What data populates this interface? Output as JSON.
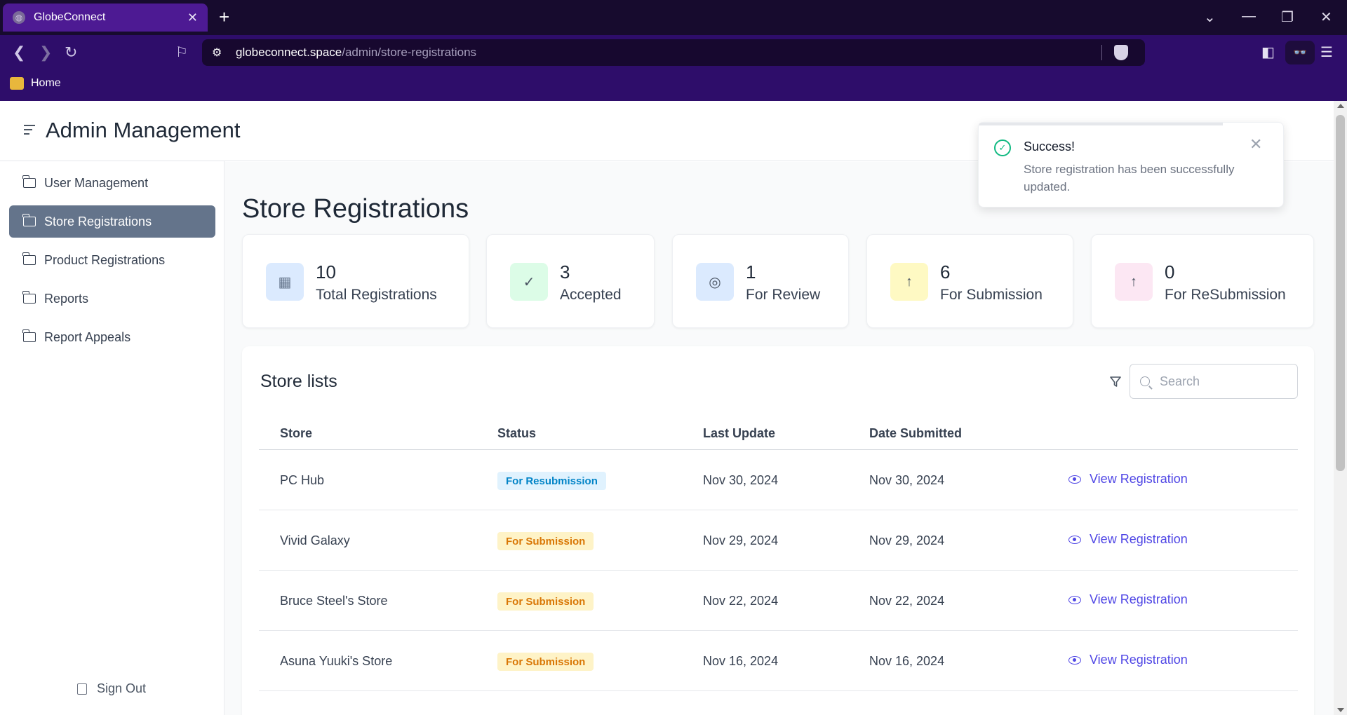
{
  "browser": {
    "tab_title": "GlobeConnect",
    "url_domain": "globeconnect.space",
    "url_path": "/admin/store-registrations",
    "bookmark_home": "Home"
  },
  "header": {
    "title": "Admin Management"
  },
  "sidebar": {
    "items": [
      {
        "label": "User Management",
        "active": false
      },
      {
        "label": "Store Registrations",
        "active": true
      },
      {
        "label": "Product Registrations",
        "active": false
      },
      {
        "label": "Reports",
        "active": false
      },
      {
        "label": "Report Appeals",
        "active": false
      }
    ],
    "sign_out": "Sign Out"
  },
  "main": {
    "page_title": "Store Registrations",
    "stats": [
      {
        "value": "10",
        "label": "Total Registrations",
        "icon": "store-icon",
        "color": "#dbeafe"
      },
      {
        "value": "3",
        "label": "Accepted",
        "icon": "file-check-icon",
        "color": "#dcfce7"
      },
      {
        "value": "1",
        "label": "For Review",
        "icon": "file-search-icon",
        "color": "#dbeafe"
      },
      {
        "value": "6",
        "label": "For Submission",
        "icon": "file-upload-icon",
        "color": "#fef9c3"
      },
      {
        "value": "0",
        "label": "For ReSubmission",
        "icon": "file-upload-icon",
        "color": "#fce7f3"
      }
    ],
    "list": {
      "title": "Store lists",
      "search_placeholder": "Search",
      "columns": [
        "Store",
        "Status",
        "Last Update",
        "Date Submitted"
      ],
      "action_label": "View Registration",
      "rows": [
        {
          "store": "PC Hub",
          "status": "For Resubmission",
          "last_update": "Nov 30, 2024",
          "date_submitted": "Nov 30, 2024"
        },
        {
          "store": "Vivid Galaxy",
          "status": "For Submission",
          "last_update": "Nov 29, 2024",
          "date_submitted": "Nov 29, 2024"
        },
        {
          "store": "Bruce Steel's Store",
          "status": "For Submission",
          "last_update": "Nov 22, 2024",
          "date_submitted": "Nov 22, 2024"
        },
        {
          "store": "Asuna Yuuki's Store",
          "status": "For Submission",
          "last_update": "Nov 16, 2024",
          "date_submitted": "Nov 16, 2024"
        }
      ]
    }
  },
  "toast": {
    "title": "Success!",
    "message": "Store registration has been successfully updated."
  },
  "colors": {
    "accent": "#4f46e5",
    "sidebar_active": "#64748b",
    "browser_tab": "#4d1a93",
    "browser_toolbar": "#2e0d6a",
    "resubmission_badge_bg": "#e0f2fe",
    "resubmission_badge_fg": "#0284c7",
    "submission_badge_bg": "#fef3c7",
    "submission_badge_fg": "#d97706",
    "success": "#10b981"
  }
}
